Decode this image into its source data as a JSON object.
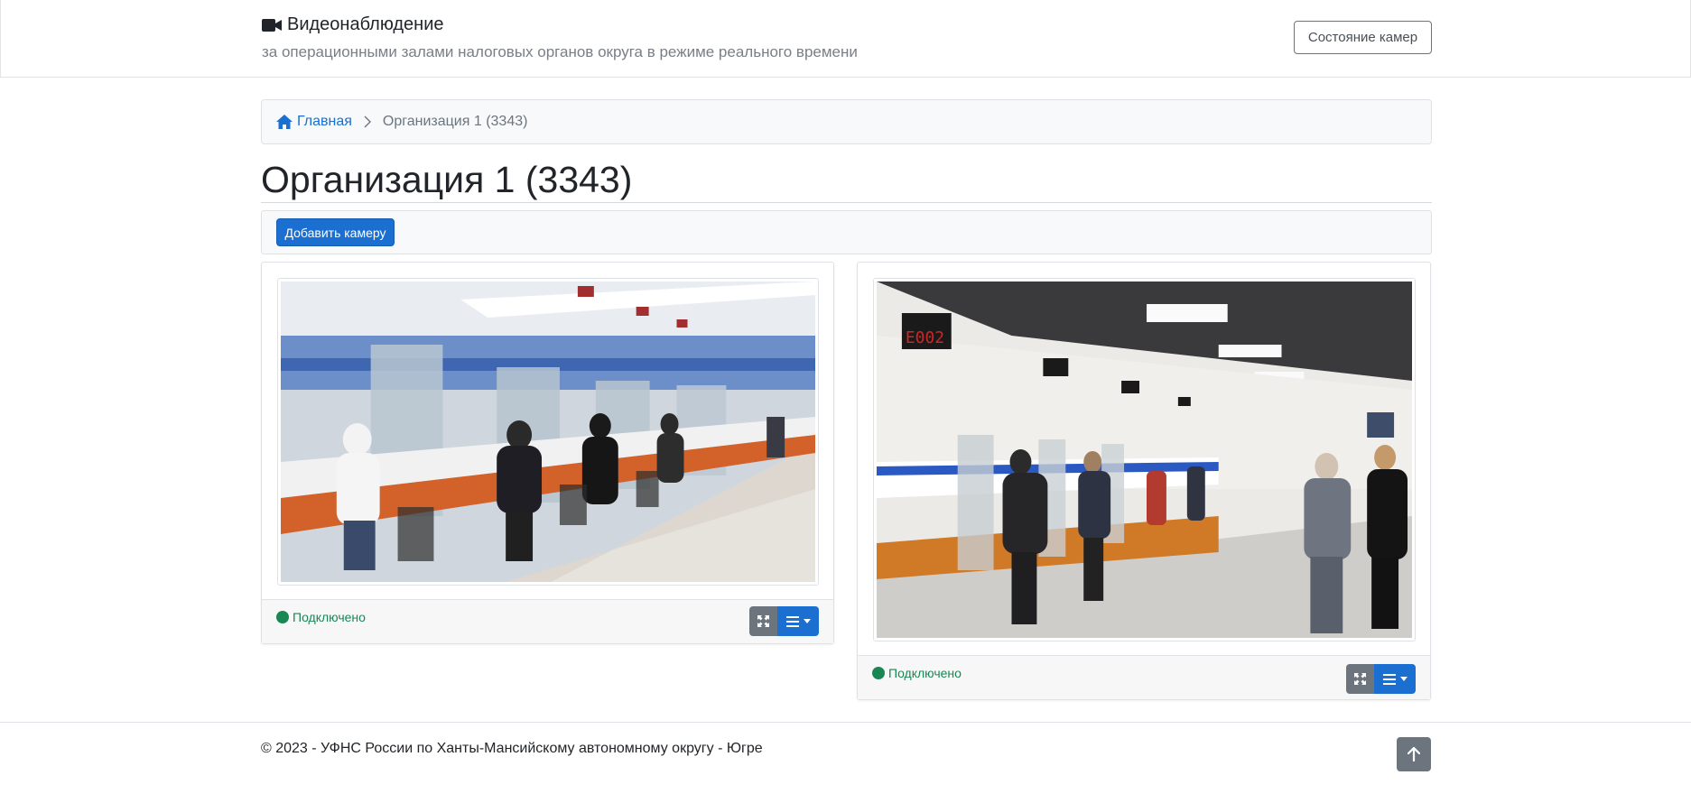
{
  "header": {
    "title": "Видеонаблюдение",
    "subtitle": "за операционными залами налоговых органов округа в режиме реального времени",
    "status_button": "Состояние камер",
    "title_icon": "video-camera-icon"
  },
  "breadcrumb": {
    "home_label": "Главная",
    "current": "Организация 1 (3343)"
  },
  "page": {
    "title": "Организация 1 (3343)"
  },
  "toolbar": {
    "add_camera_label": "Добавить камеру"
  },
  "cameras": [
    {
      "status": "Подключено",
      "status_color": "#198754"
    },
    {
      "status": "Подключено",
      "status_color": "#198754"
    }
  ],
  "footer": {
    "copyright": "© 2023 - УФНС России по Ханты-Мансийскому автономному округу - Югре"
  },
  "colors": {
    "primary": "#1a6fd1",
    "secondary": "#6c757d",
    "success": "#198754"
  }
}
